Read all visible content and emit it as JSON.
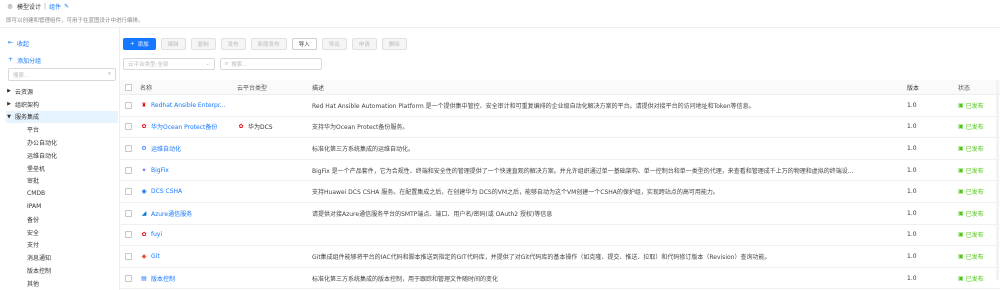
{
  "colors": {
    "accent": "#1677ff",
    "success": "#52c41a"
  },
  "breadcrumb": {
    "root": "模型设计",
    "separator": "|",
    "current": "组件"
  },
  "page_description": "即可以创建和管理组件，可用于在蓝图设计中进行编排。",
  "sidebar": {
    "collapse_label": "收起",
    "add_category_label": "添加分组",
    "search_placeholder": "搜索...",
    "tree": [
      {
        "label": "云资源",
        "expanded": false
      },
      {
        "label": "组织架构",
        "expanded": false
      },
      {
        "label": "服务集成",
        "expanded": true,
        "active": true
      }
    ],
    "children": [
      "平台",
      "办公自动化",
      "运维自动化",
      "堡垒机",
      "审批",
      "CMDB",
      "IPAM",
      "备份",
      "安全",
      "支付",
      "消息通知",
      "版本控制",
      "其他"
    ]
  },
  "toolbar": {
    "add": "添加",
    "edit": "编辑",
    "copy": "复制",
    "publish": "发布",
    "new_version": "新版发布",
    "import": "导入",
    "export": "导出",
    "apply": "申请",
    "delete": "删除"
  },
  "filters": {
    "platform_placeholder": "云平台类型:全部",
    "search_placeholder": "搜索..."
  },
  "table": {
    "headers": {
      "name": "名称",
      "platform": "云平台类型",
      "description": "描述",
      "version": "版本",
      "status": "状态"
    },
    "rows": [
      {
        "name": "Redhat Ansible Enterpr...",
        "icon": "redhat-icon",
        "platform": "",
        "description": "Red Hat Ansible Automation Platform 是一个提供集中管控、安全审计和可重复编排的企业级自动化解决方案的平台。请提供对接平台的访问地址和Token等信息。",
        "version": "1.0",
        "status": "已发布"
      },
      {
        "name": "华为Ocean Protect备份",
        "icon": "huawei-icon",
        "platform": "华为DCS",
        "description": "支持华为Ocean Protect备份服务。",
        "version": "1.0",
        "status": "已发布"
      },
      {
        "name": "运维自动化",
        "icon": "gear-icon",
        "platform": "",
        "description": "标准化第三方系统集成的运维自动化。",
        "version": "1.0",
        "status": "已发布"
      },
      {
        "name": "BigFix",
        "icon": "bigfix-icon",
        "platform": "",
        "description": "BigFix 是一个产品套件，它为合规性、终端和安全性的管理提供了一个快速直观的解决方案。并允许组织通过单一基础架构、单一控制台和单一类型的代理，来查看和管理成千上万的物理和虚拟的终端设...",
        "version": "1.0",
        "status": "已发布"
      },
      {
        "name": "DCS CSHA",
        "icon": "globe-icon",
        "platform": "",
        "description": "支持Huawei DCS CSHA 服务。在配置集成之后，在创建华为 DCS的VM之后，能够自动为这个VM创建一个CSHA的保护组，实现跨站点的高可用能力。",
        "version": "1.0",
        "status": "已发布"
      },
      {
        "name": "Azure通信服务",
        "icon": "azure-icon",
        "platform": "",
        "description": "请提供对接Azure通信服务平台的SMTP端点、端口、用户名/密码(或 OAuth2 授权)等信息",
        "version": "1.0",
        "status": "已发布"
      },
      {
        "name": "fuyi",
        "icon": "huawei-icon",
        "platform": "",
        "description": "",
        "version": "1.0",
        "status": "已发布"
      },
      {
        "name": "Git",
        "icon": "git-icon",
        "platform": "",
        "description": "Git集成组件能够将平台的IAC代码和脚本推送到指定的GIT代码库，并提供了对Git代码库的基本操作（如克隆、提交、推送、拉取）和代码修订版本（Revision）查询功能。",
        "version": "1.0",
        "status": "已发布"
      },
      {
        "name": "版本控制",
        "icon": "version-icon",
        "platform": "",
        "description": "标准化第三方系统集成的版本控制，用于跟踪和管理文件随时间的变化",
        "version": "1.0",
        "status": "已发布"
      }
    ]
  }
}
